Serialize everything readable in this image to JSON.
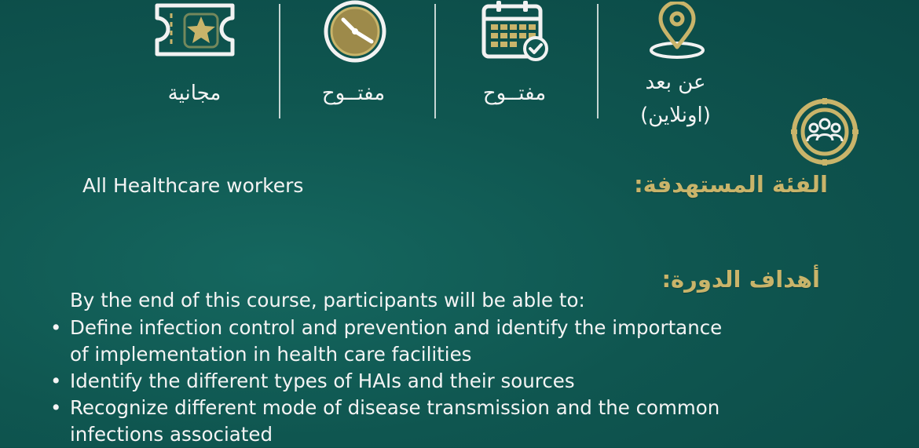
{
  "info": {
    "cost": {
      "icon": "ticket-star-icon",
      "value": "مجانية"
    },
    "time": {
      "icon": "clock-icon",
      "value": "مفتــوح"
    },
    "date": {
      "icon": "calendar-check-icon",
      "value": "مفتــوح"
    },
    "location": {
      "icon": "location-pin-icon",
      "value_line1": "عن بعد",
      "value_line2": "(اونلاين)"
    }
  },
  "audience": {
    "icon": "people-group-icon",
    "heading": "الفئة المستهدفة:",
    "value": "All Healthcare workers"
  },
  "objectives": {
    "heading": "أهداف الدورة:",
    "intro": "By the end of this course, participants will be able to:",
    "items": [
      {
        "line1": "Define infection control and prevention and identify the importance",
        "line2": "of implementation in health care facilities"
      },
      {
        "line1": "Identify the different types of HAIs and their sources",
        "line2": ""
      },
      {
        "line1": "Recognize different mode of disease transmission and the common",
        "line2": "infections associated"
      }
    ]
  },
  "colors": {
    "background": "#0f5650",
    "accent_gold": "#c9b46a",
    "text": "#f4f4f4"
  }
}
